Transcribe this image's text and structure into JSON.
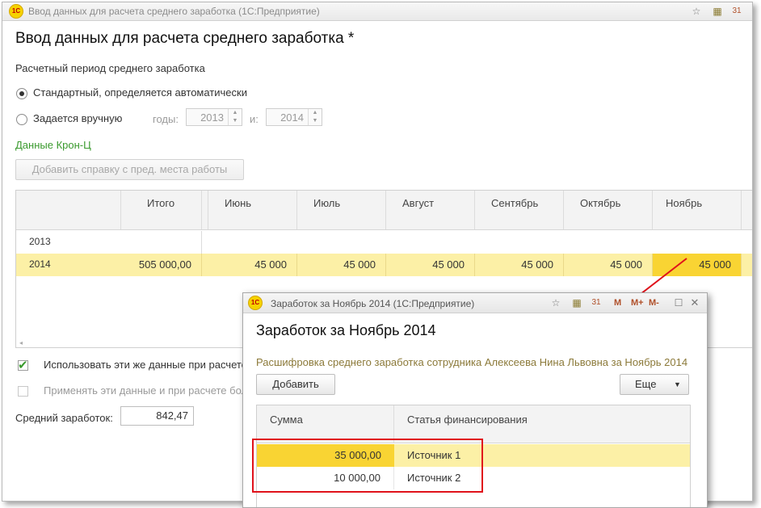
{
  "main_window": {
    "title": "Ввод данных для расчета среднего заработка  (1С:Предприятие)",
    "heading": "Ввод данных для расчета среднего заработка *",
    "period_label": "Расчетный период среднего заработка",
    "radio_standard": "Стандартный, определяется автоматически",
    "radio_manual": "Задается вручную",
    "years_label": "годы:",
    "year_from": "2013",
    "and_label": "и:",
    "year_to": "2014",
    "data_source": "Данные Крон-Ц",
    "add_reference_button": "Добавить справку с пред. места работы",
    "grid": {
      "columns": [
        "Итого",
        "Июнь",
        "Июль",
        "Август",
        "Сентябрь",
        "Октябрь",
        "Ноябрь"
      ],
      "rows": [
        {
          "year": "2013",
          "values": [
            "",
            "",
            "",
            "",
            "",
            "",
            ""
          ]
        },
        {
          "year": "2014",
          "values": [
            "505 000,00",
            "45 000",
            "45 000",
            "45 000",
            "45 000",
            "45 000",
            "45 000"
          ]
        }
      ]
    },
    "use_same_data_label": "Использовать эти же данные при расчете",
    "apply_data_label": "Применять эти данные и при расчете бол",
    "avg_earnings_label": "Средний заработок:",
    "avg_earnings_value": "842,47"
  },
  "popup": {
    "title": "Заработок за Ноябрь 2014  (1С:Предприятие)",
    "heading": "Заработок за Ноябрь 2014",
    "description": "Расшифровка среднего заработка сотрудника Алексеева Нина Львовна за Ноябрь 2014",
    "add_button": "Добавить",
    "more_button": "Еще",
    "toolbar_m": "M",
    "toolbar_mplus": "M+",
    "toolbar_mminus": "M-",
    "columns": [
      "Сумма",
      "Статья финансирования"
    ],
    "rows": [
      {
        "amount": "35 000,00",
        "source": "Источник 1"
      },
      {
        "amount": "10 000,00",
        "source": "Источник 2"
      }
    ]
  },
  "colors": {
    "highlight_row": "#fcf0a6",
    "selected_cell": "#f9d433",
    "green_label": "#3a9a2e",
    "annotation_red": "#e0121b"
  }
}
